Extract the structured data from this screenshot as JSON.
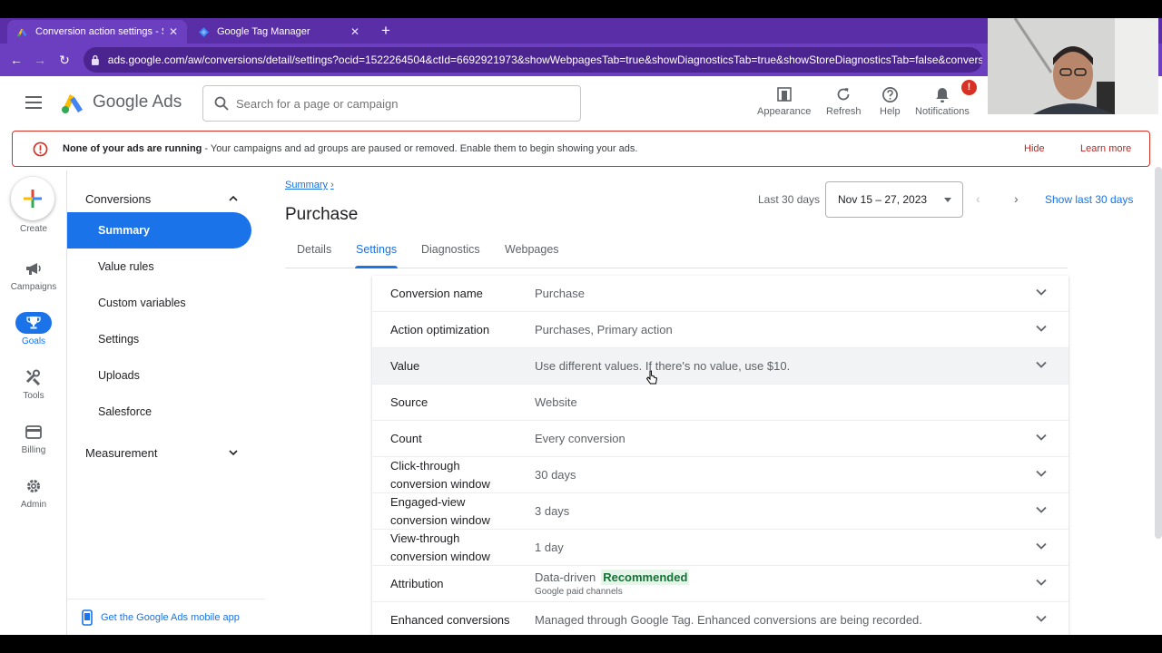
{
  "browser": {
    "tabs": [
      {
        "title": "Conversion action settings - Sha",
        "active": true
      },
      {
        "title": "Google Tag Manager",
        "active": false
      }
    ],
    "url": "ads.google.com/aw/conversions/detail/settings?ocid=1522264504&ctId=6692921973&showWebpagesTab=true&showDiagnosticsTab=true&showStoreDiagnosticsTab=false&conversio..."
  },
  "header": {
    "product_name": "Google Ads",
    "search_placeholder": "Search for a page or campaign",
    "tools": [
      {
        "label": "Appearance",
        "icon": "appearance-icon"
      },
      {
        "label": "Refresh",
        "icon": "refresh-icon"
      },
      {
        "label": "Help",
        "icon": "help-icon"
      },
      {
        "label": "Notifications",
        "icon": "bell-icon",
        "badge": "!"
      }
    ]
  },
  "banner": {
    "bold": "None of your ads are running",
    "text": "- Your campaigns and ad groups are paused or removed. Enable them to begin showing your ads.",
    "hide": "Hide",
    "learn_more": "Learn more"
  },
  "rail": [
    {
      "label": "Create",
      "icon": "plus-icon"
    },
    {
      "label": "Campaigns",
      "icon": "megaphone-icon"
    },
    {
      "label": "Goals",
      "icon": "trophy-icon",
      "active": true
    },
    {
      "label": "Tools",
      "icon": "tools-icon"
    },
    {
      "label": "Billing",
      "icon": "card-icon"
    },
    {
      "label": "Admin",
      "icon": "gear-icon"
    }
  ],
  "sidenav": {
    "section1": "Conversions",
    "items": [
      "Summary",
      "Value rules",
      "Custom variables",
      "Settings",
      "Uploads",
      "Salesforce"
    ],
    "active_index": 0,
    "section2": "Measurement",
    "mobile_app": "Get the Google Ads mobile app"
  },
  "main": {
    "breadcrumb": "Summary",
    "title": "Purchase",
    "date_label": "Last 30 days",
    "date_range": "Nov 15 – 27, 2023",
    "show_last": "Show last 30 days",
    "tabs": [
      "Details",
      "Settings",
      "Diagnostics",
      "Webpages"
    ],
    "active_tab": 1,
    "settings": [
      {
        "label": "Conversion name",
        "value": "Purchase",
        "expandable": true
      },
      {
        "label": "Action optimization",
        "value": "Purchases, Primary action",
        "expandable": true
      },
      {
        "label": "Value",
        "value": "Use different values. If there's no value, use $10.",
        "expandable": true
      },
      {
        "label": "Source",
        "value": "Website",
        "expandable": false
      },
      {
        "label": "Count",
        "value": "Every conversion",
        "expandable": true
      },
      {
        "label": "Click-through conversion window",
        "value": "30 days",
        "expandable": true
      },
      {
        "label": "Engaged-view conversion window",
        "value": "3 days",
        "expandable": true
      },
      {
        "label": "View-through conversion window",
        "value": "1 day",
        "expandable": true
      },
      {
        "label": "Attribution",
        "value": "Data-driven",
        "badge": "Recommended",
        "sub": "Google paid channels",
        "expandable": true
      },
      {
        "label": "Enhanced conversions",
        "value": "Managed through Google Tag. Enhanced conversions are being recorded.",
        "expandable": true
      }
    ]
  }
}
